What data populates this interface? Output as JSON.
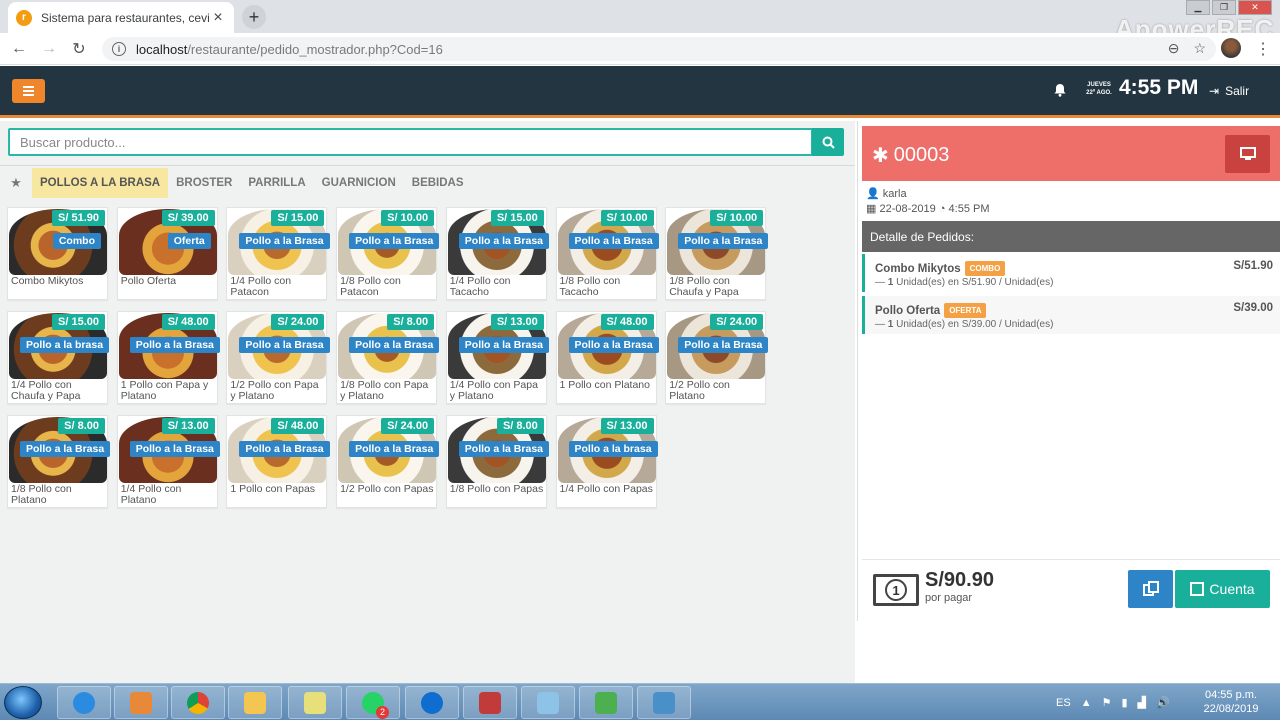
{
  "browser": {
    "tab_title": "Sistema para restaurantes, cevich",
    "tab_close": "×",
    "new_tab": "+",
    "url_host": "localhost",
    "url_path": "/restaurante/pedido_mostrador.php?Cod=16",
    "watermark": "ApowerREC"
  },
  "header": {
    "date_line1": "JUEVES",
    "date_line2": "22º AGO.",
    "time": "4:55 PM",
    "logout_label": "Salir"
  },
  "search": {
    "placeholder": "Buscar producto..."
  },
  "categories": [
    "POLLOS A LA BRASA",
    "BROSTER",
    "PARRILLA",
    "GUARNICION",
    "BEBIDAS"
  ],
  "products": [
    {
      "price": "S/ 51.90",
      "tag": "Combo",
      "name": "Combo Mikytos"
    },
    {
      "price": "S/ 39.00",
      "tag": "Oferta",
      "name": "Pollo Oferta"
    },
    {
      "price": "S/ 15.00",
      "tag": "Pollo a la Brasa",
      "name": "1/4 Pollo con Patacon"
    },
    {
      "price": "S/ 10.00",
      "tag": "Pollo a la Brasa",
      "name": "1/8 Pollo con Patacon"
    },
    {
      "price": "S/ 15.00",
      "tag": "Pollo a la Brasa",
      "name": "1/4 Pollo con Tacacho"
    },
    {
      "price": "S/ 10.00",
      "tag": "Pollo a la Brasa",
      "name": "1/8 Pollo con Tacacho"
    },
    {
      "price": "S/ 10.00",
      "tag": "Pollo a la Brasa",
      "name": "1/8 Pollo con Chaufa y Papa"
    },
    {
      "price": "S/ 15.00",
      "tag": "Pollo a la brasa",
      "name": "1/4 Pollo con Chaufa y Papa"
    },
    {
      "price": "S/ 48.00",
      "tag": "Pollo a la Brasa",
      "name": "1 Pollo con Papa y Platano"
    },
    {
      "price": "S/ 24.00",
      "tag": "Pollo a la Brasa",
      "name": "1/2 Pollo con Papa y Platano"
    },
    {
      "price": "S/ 8.00",
      "tag": "Pollo a la Brasa",
      "name": "1/8 Pollo con Papa y Platano"
    },
    {
      "price": "S/ 13.00",
      "tag": "Pollo a la Brasa",
      "name": "1/4 Pollo con Papa y Platano"
    },
    {
      "price": "S/ 48.00",
      "tag": "Pollo a la Brasa",
      "name": "1 Pollo con Platano"
    },
    {
      "price": "S/ 24.00",
      "tag": "Pollo a la Brasa",
      "name": "1/2 Pollo con Platano"
    },
    {
      "price": "S/ 8.00",
      "tag": "Pollo a la Brasa",
      "name": "1/8 Pollo con Platano"
    },
    {
      "price": "S/ 13.00",
      "tag": "Pollo a la Brasa",
      "name": "1/4 Pollo con Platano"
    },
    {
      "price": "S/ 48.00",
      "tag": "Pollo a la Brasa",
      "name": "1 Pollo con Papas"
    },
    {
      "price": "S/ 24.00",
      "tag": "Pollo a la Brasa",
      "name": "1/2 Pollo con Papas"
    },
    {
      "price": "S/ 8.00",
      "tag": "Pollo a la Brasa",
      "name": "1/8 Pollo con Papas"
    },
    {
      "price": "S/ 13.00",
      "tag": "Pollo a la brasa",
      "name": "1/4 Pollo con Papas"
    }
  ],
  "order": {
    "number": "00003",
    "user": "karla",
    "date": "22-08-2019",
    "time": "4:55 PM",
    "details_title": "Detalle de Pedidos:",
    "items": [
      {
        "name": "Combo Mikytos",
        "badge": "COMBO",
        "qty": "1",
        "desc": "Unidad(es) en S/51.90 / Unidad(es)",
        "price": "S/51.90"
      },
      {
        "name": "Pollo Oferta",
        "badge": "OFERTA",
        "qty": "1",
        "desc": "Unidad(es) en S/39.00 / Unidad(es)",
        "price": "S/39.00"
      }
    ],
    "total": "S/90.90",
    "total_caption": "por pagar",
    "bill_symbol": "1",
    "account_button": "Cuenta"
  },
  "taskbar": {
    "lang": "ES",
    "time": "04:55 p.m.",
    "date": "22/08/2019",
    "whatsapp_badge": "2"
  },
  "colors": {
    "header_bg": "#233540",
    "accent_orange": "#f0862c",
    "teal": "#1aaf9a",
    "blue": "#2d85c7",
    "order_header": "#ee6e6a",
    "category_active": "#f7e7a0"
  }
}
